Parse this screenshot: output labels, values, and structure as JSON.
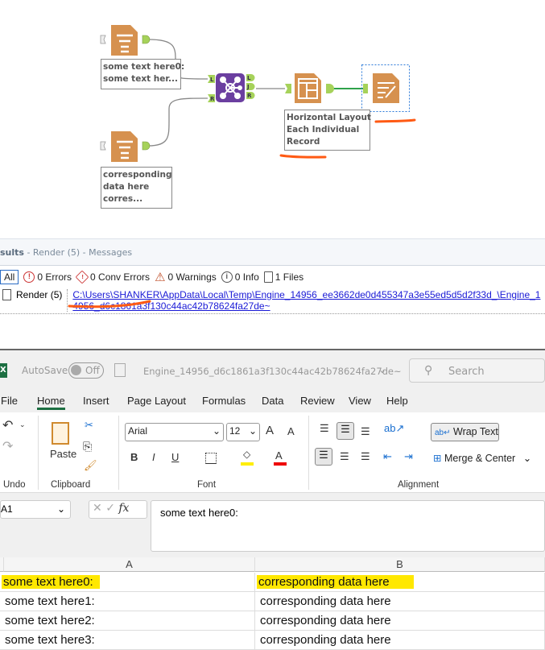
{
  "workflow": {
    "tools": [
      {
        "name": "Text Input 1",
        "annotation": [
          "some text here0:",
          "some text her..."
        ]
      },
      {
        "name": "Text Input 2",
        "annotation": [
          "corresponding",
          "data here",
          "corres..."
        ]
      },
      {
        "name": "Join",
        "anchors_in": [
          "L",
          "R"
        ],
        "anchors_out": [
          "L",
          "J",
          "R"
        ]
      },
      {
        "name": "Layout",
        "annotation": [
          "Horizontal Layout",
          "Each Individual",
          "Record"
        ]
      },
      {
        "name": "Render"
      }
    ],
    "colors": {
      "tool": "#d6914f",
      "join": "#6b3fa0",
      "anchor": "#a6d25a",
      "highlight": "#ff5a14"
    }
  },
  "results": {
    "title": "sults",
    "subtitle": " - Render (5) - Messages",
    "filters": [
      "All",
      "0 Errors",
      "0 Conv Errors",
      "0 Warnings",
      "0 Info",
      "1 Files"
    ],
    "row": {
      "tool": "Render (5)",
      "path": "C:\\Users\\SHANKER\\AppData\\Local\\Temp\\Engine_14956_ee3662de0d455347a3e55ed5d5d2f33d_\\Engine_14956_d6c1861a3f130c44ac42b78624fa27de~"
    }
  },
  "excel": {
    "app_icon": "X",
    "autosave": "AutoSave",
    "autosave_state": "Off",
    "filename": "Engine_14956_d6c1861a3f130c44ac42b78624fa27de~",
    "search_placeholder": "Search",
    "tabs": [
      "File",
      "Home",
      "Insert",
      "Page Layout",
      "Formulas",
      "Data",
      "Review",
      "View",
      "Help"
    ],
    "active_tab": "Home",
    "ribbon": {
      "undo_label": "Undo",
      "paste_label": "Paste",
      "clipboard_label": "Clipboard",
      "font_name": "Arial",
      "font_size": "12",
      "font_label": "Font",
      "bold": "B",
      "italic": "I",
      "underline": "U",
      "grow": "A",
      "shrink": "A",
      "font_color": "A",
      "wrap_text": "Wrap Text",
      "merge_center": "Merge & Center",
      "alignment_label": "Alignment"
    },
    "name_box": "A1",
    "fx": "fx",
    "formula": "some text here0:",
    "columns": [
      "A",
      "B"
    ],
    "rows": [
      [
        "some text here0:",
        "corresponding data here"
      ],
      [
        "some text here1:",
        "corresponding data here"
      ],
      [
        "some text here2:",
        "corresponding data here"
      ],
      [
        "some text here3:",
        "corresponding data here"
      ]
    ]
  }
}
